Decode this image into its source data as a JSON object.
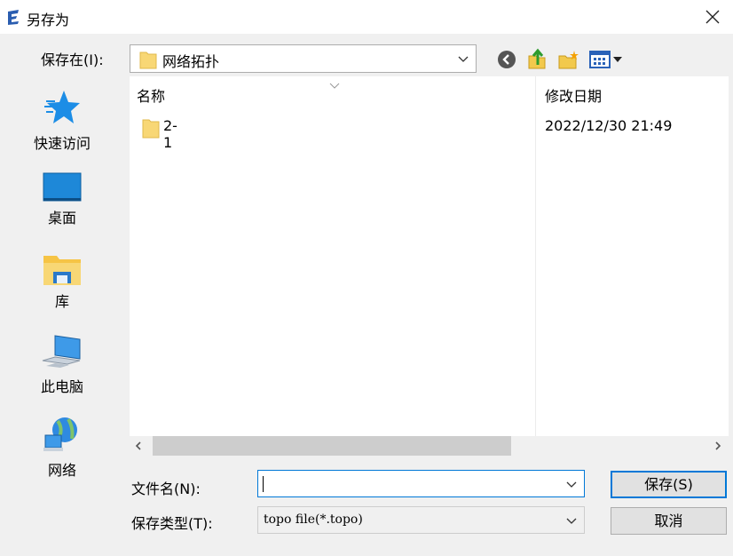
{
  "window": {
    "title": "另存为"
  },
  "location": {
    "label": "保存在(I):",
    "value": "网络拓扑"
  },
  "places": [
    {
      "label": "快速访问",
      "icon": "star-icon"
    },
    {
      "label": "桌面",
      "icon": "desktop-icon"
    },
    {
      "label": "库",
      "icon": "library-folder-icon"
    },
    {
      "label": "此电脑",
      "icon": "computer-icon"
    },
    {
      "label": "网络",
      "icon": "network-globe-icon"
    }
  ],
  "list": {
    "columns": [
      "名称",
      "修改日期"
    ],
    "rows": [
      {
        "name": "2-1",
        "modified": "2022/12/30 21:49"
      }
    ]
  },
  "filename": {
    "label": "文件名(N):",
    "value": ""
  },
  "filetype": {
    "label": "保存类型(T):",
    "value": "topo file(*.topo)"
  },
  "buttons": {
    "save": "保存(S)",
    "cancel": "取消"
  },
  "colors": {
    "accent": "#0078d7",
    "folder": "#f8d775",
    "background": "#f0f0f0"
  }
}
